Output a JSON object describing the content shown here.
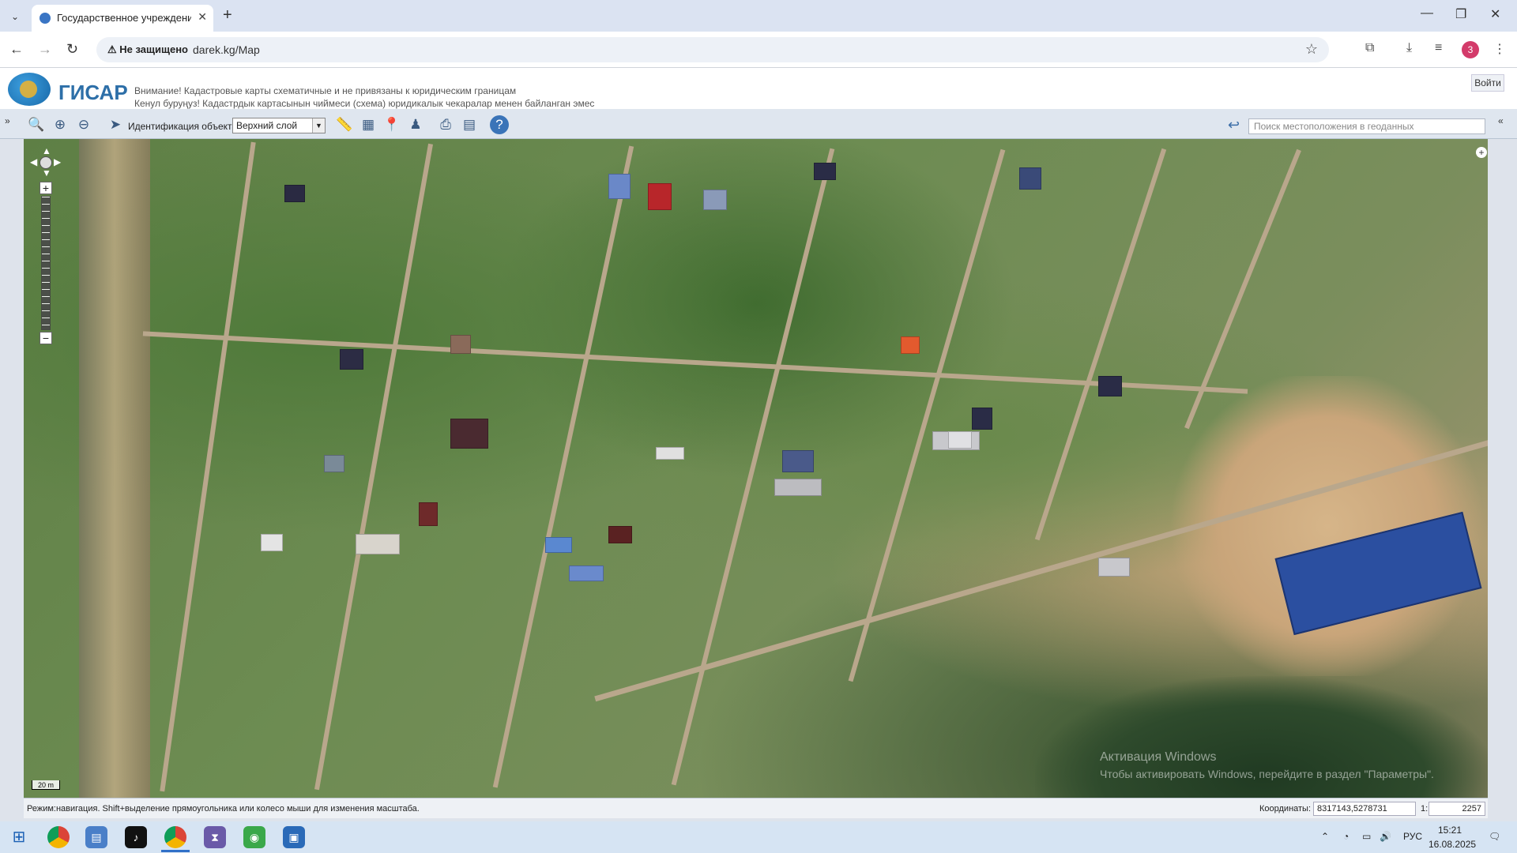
{
  "browser": {
    "tab_title": "Государственное учреждение",
    "insecure_label": "Не защищено",
    "url": "darek.kg/Map",
    "profile_initial": "3"
  },
  "app": {
    "brand": "ГИСАР",
    "notice_ru": "Внимание! Кадастровые карты схематичные и не привязаны к юридическим границам",
    "notice_ky": "Кенул буруңуз! Кадастрдык картасынын чиймеси (схема) юридикалык чекаралар менен байланган эмес",
    "login_label": "Войти"
  },
  "toolbar": {
    "ident_label": "Идентификация объекта:",
    "layer_selected": "Верхний слой",
    "geo_search_placeholder": "Поиск местоположения в геоданных"
  },
  "map": {
    "scale_label": "20 m",
    "watermark_line1": "Активация Windows",
    "watermark_line2": "Чтобы активировать Windows, перейдите в раздел \"Параметры\"."
  },
  "status": {
    "mode_text": "Режим:навигация. Shift+выделение прямоугольника или колесо мыши для изменения масштаба.",
    "coord_label": "Координаты:",
    "coord_value": "8317143,5278731",
    "scale_prefix": "1:",
    "scale_value": "2257"
  },
  "taskbar": {
    "lang": "РУС",
    "time": "15:21",
    "date": "16.08.2025"
  }
}
